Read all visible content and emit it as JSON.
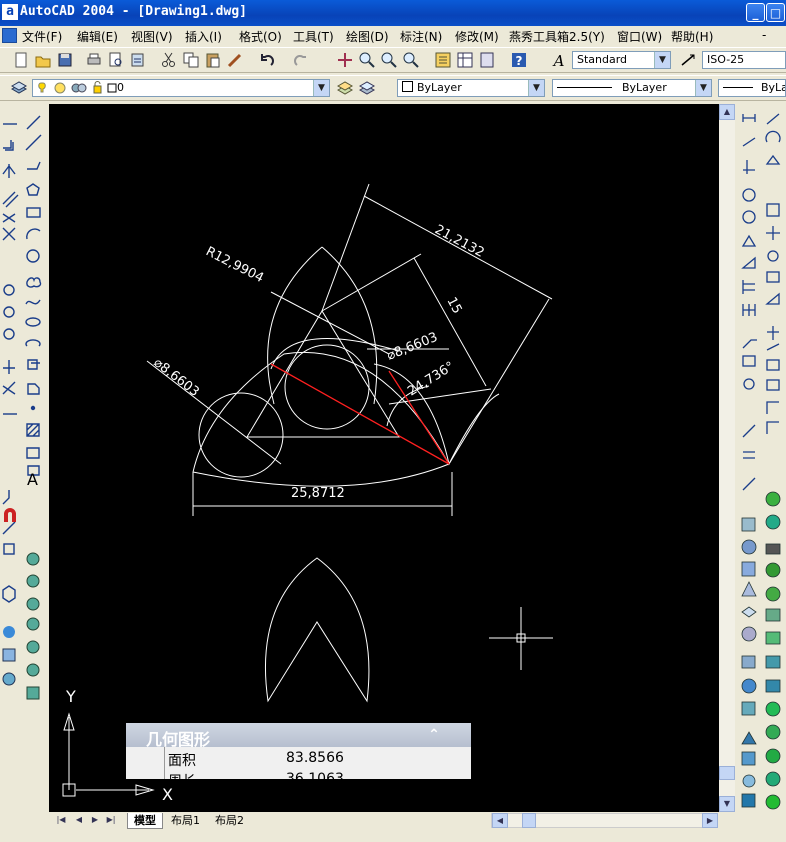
{
  "window": {
    "title": "AutoCAD 2004 - [Drawing1.dwg]",
    "app_letter": "a",
    "minimize_glyph": "_",
    "restore_glyph": "□"
  },
  "menubar": {
    "items": [
      {
        "label": "文件(F)"
      },
      {
        "label": "编辑(E)"
      },
      {
        "label": "视图(V)"
      },
      {
        "label": "插入(I)"
      },
      {
        "label": "格式(O)"
      },
      {
        "label": "工具(T)"
      },
      {
        "label": "绘图(D)"
      },
      {
        "label": "标注(N)"
      },
      {
        "label": "修改(M)"
      },
      {
        "label": "燕秀工具箱2.5(Y)"
      },
      {
        "label": "窗口(W)"
      },
      {
        "label": "帮助(H)"
      }
    ],
    "doc_min": "-"
  },
  "toolbar": {
    "text_style": "Standard",
    "dim_style": "ISO-25"
  },
  "layers": {
    "current_layer": "0",
    "color": "ByLayer",
    "linetype": "ByLayer",
    "lineweight": "ByLa"
  },
  "drawing": {
    "dims": {
      "radius": "R12,9904",
      "dia_left": "⌀8,6603",
      "dia_center": "⌀8,6603",
      "aligned_top": "21,2132",
      "aligned_side": "15",
      "angle": "24,736°",
      "linear_bottom": "25,8712"
    },
    "ucs": {
      "x": "X",
      "y": "Y"
    }
  },
  "properties_panel": {
    "title": "几何图形",
    "collapse_glyph": "⌃",
    "rows": [
      {
        "label": "面积",
        "value": "83.8566"
      },
      {
        "label": "周长",
        "value": "36.1063"
      }
    ]
  },
  "tabs": {
    "model": "模型",
    "layout1": "布局1",
    "layout2": "布局2"
  }
}
